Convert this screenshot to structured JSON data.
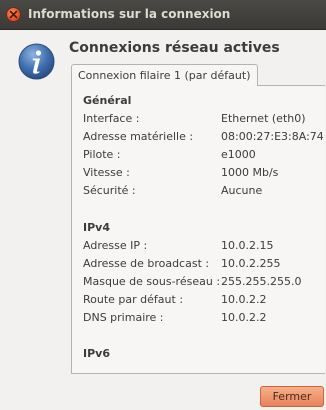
{
  "window": {
    "title": "Informations sur la connexion"
  },
  "heading": "Connexions réseau actives",
  "tabs": [
    {
      "label": "Connexion filaire 1 (par défaut)",
      "active": true
    }
  ],
  "general": {
    "title": "Général",
    "rows": [
      {
        "label": "Interface :",
        "value": "Ethernet (eth0)"
      },
      {
        "label": "Adresse matérielle :",
        "value": "08:00:27:E3:8A:74"
      },
      {
        "label": "Pilote :",
        "value": "e1000"
      },
      {
        "label": "Vitesse :",
        "value": "1000 Mb/s"
      },
      {
        "label": "Sécurité :",
        "value": "Aucune"
      }
    ]
  },
  "ipv4": {
    "title": "IPv4",
    "rows": [
      {
        "label": "Adresse IP :",
        "value": "10.0.2.15"
      },
      {
        "label": "Adresse de broadcast :",
        "value": "10.0.2.255"
      },
      {
        "label": "Masque de sous-réseau :",
        "value": "255.255.255.0"
      },
      {
        "label": "Route par défaut :",
        "value": "10.0.2.2"
      },
      {
        "label": "DNS primaire :",
        "value": "10.0.2.2"
      }
    ]
  },
  "ipv6": {
    "title": "IPv6"
  },
  "buttons": {
    "close_label": "Fermer"
  },
  "colors": {
    "titlebar": "#3c3b37",
    "close_button": "#dd4d1f",
    "info_icon": "#3f6fae",
    "primary_button": "#e8825b"
  },
  "icons": {
    "window_close": "close-icon",
    "dialog": "info-icon"
  }
}
